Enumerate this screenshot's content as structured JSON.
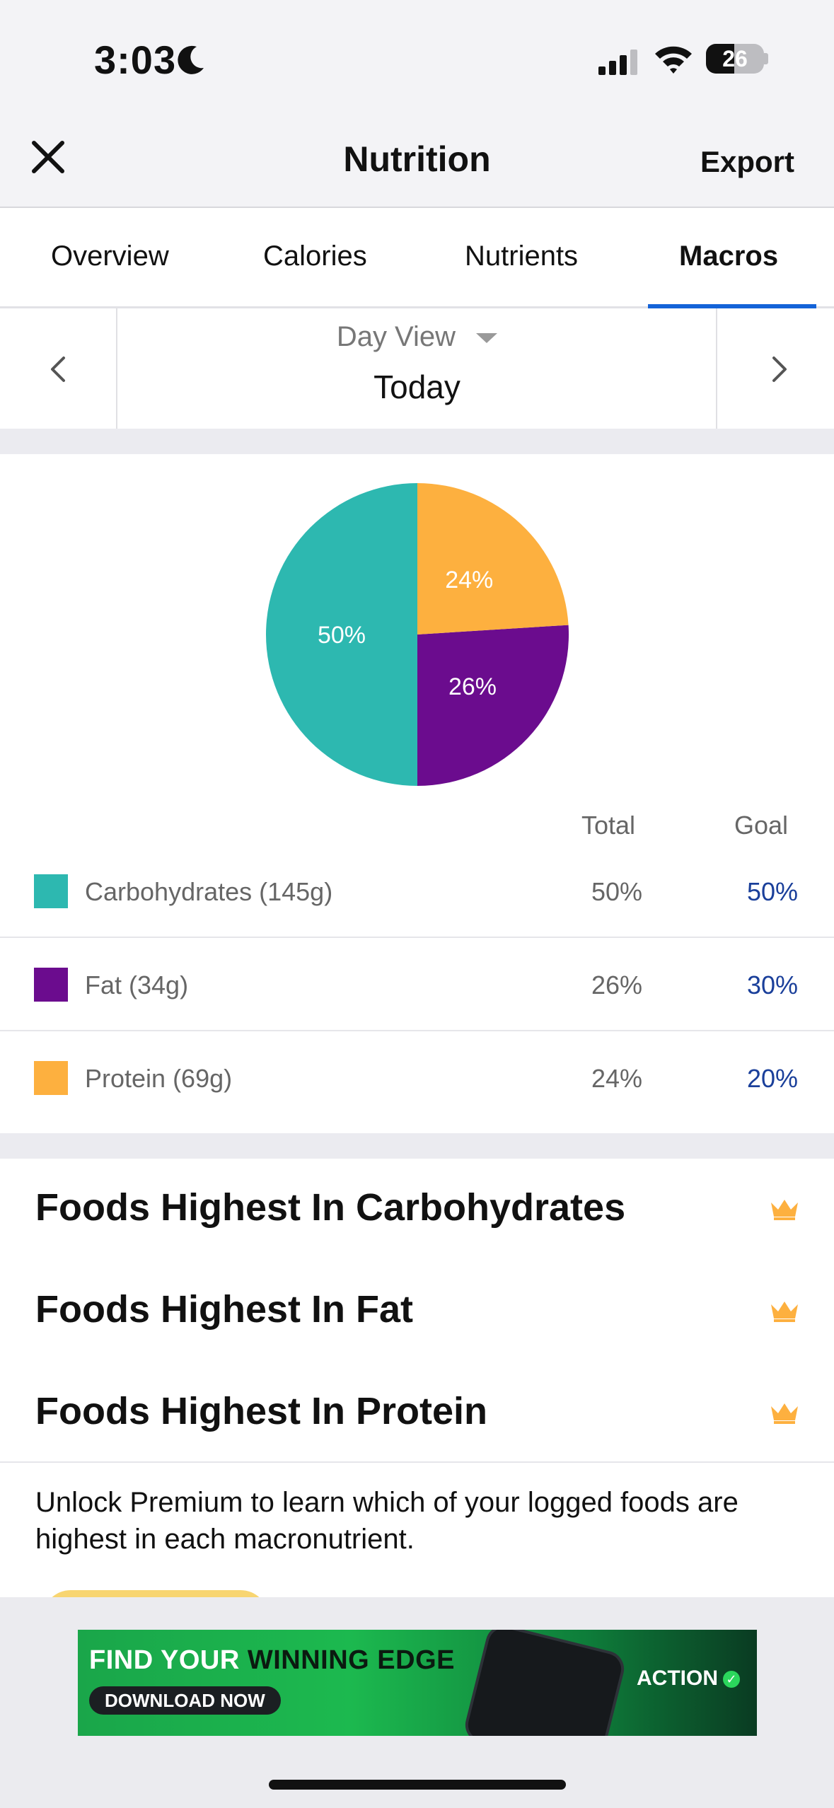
{
  "status_bar": {
    "time": "3:03",
    "battery_level": "26"
  },
  "header": {
    "title": "Nutrition",
    "export_label": "Export",
    "close_icon": "close-icon"
  },
  "tabs": [
    {
      "label": "Overview",
      "active": false
    },
    {
      "label": "Calories",
      "active": false
    },
    {
      "label": "Nutrients",
      "active": false
    },
    {
      "label": "Macros",
      "active": true
    }
  ],
  "date_selector": {
    "view_label": "Day View",
    "date_label": "Today"
  },
  "chart_data": {
    "type": "pie",
    "slices": [
      {
        "name": "Carbohydrates",
        "value": 50,
        "label": "50%",
        "color": "#2db8b0"
      },
      {
        "name": "Fat",
        "value": 26,
        "label": "26%",
        "color": "#6b0c8e"
      },
      {
        "name": "Protein",
        "value": 24,
        "label": "24%",
        "color": "#fdb03f"
      }
    ]
  },
  "macros_table": {
    "total_header": "Total",
    "goal_header": "Goal",
    "rows": [
      {
        "label": "Carbohydrates (145g)",
        "total": "50%",
        "goal": "50%",
        "color": "#2db8b0"
      },
      {
        "label": "Fat (34g)",
        "total": "26%",
        "goal": "30%",
        "color": "#6b0c8e"
      },
      {
        "label": "Protein (69g)",
        "total": "24%",
        "goal": "20%",
        "color": "#fdb03f"
      }
    ]
  },
  "foods_highest": {
    "items": [
      {
        "label": "Foods Highest In Carbohydrates"
      },
      {
        "label": "Foods Highest In Fat"
      },
      {
        "label": "Foods Highest In Protein"
      }
    ],
    "premium_text": "Unlock Premium to learn which of your logged foods are highest in each macronutrient."
  },
  "ad": {
    "headline_part1": "FIND YOUR ",
    "headline_part2": "WINNING EDGE",
    "cta": "DOWNLOAD NOW",
    "brand": "ACTION"
  },
  "colors": {
    "accent": "#1463d8",
    "goal_text": "#1a3f9a",
    "crown": "#fdb03f"
  }
}
